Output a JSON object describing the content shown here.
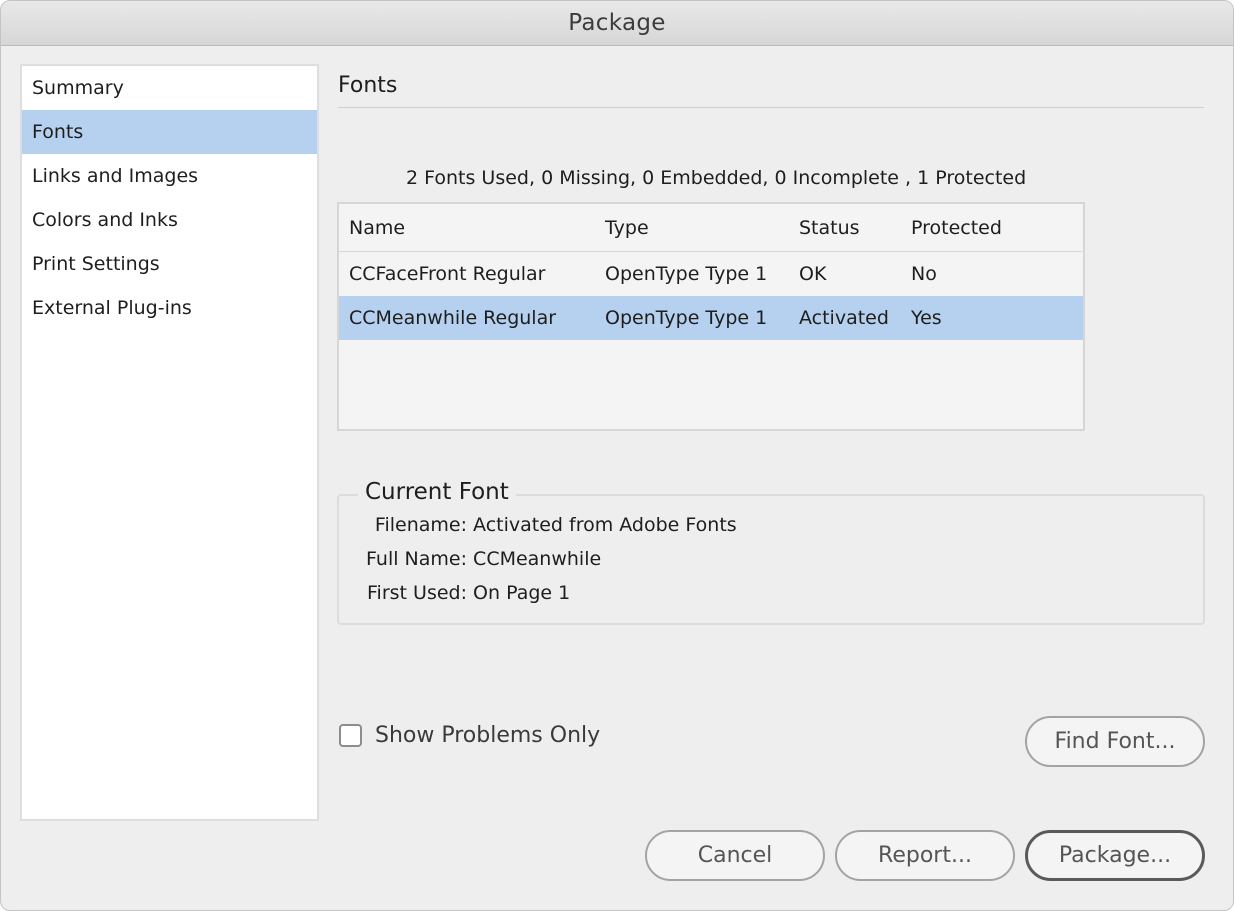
{
  "window": {
    "title": "Package"
  },
  "sidebar": {
    "items": [
      {
        "label": "Summary"
      },
      {
        "label": "Fonts"
      },
      {
        "label": "Links and Images"
      },
      {
        "label": "Colors and Inks"
      },
      {
        "label": "Print Settings"
      },
      {
        "label": "External Plug-ins"
      }
    ],
    "selected": "Fonts"
  },
  "fonts_section": {
    "title": "Fonts",
    "summary": "2 Fonts Used, 0 Missing, 0 Embedded, 0 Incomplete , 1 Protected",
    "table": {
      "columns": [
        "Name",
        "Type",
        "Status",
        "Protected"
      ],
      "rows": [
        {
          "name": "CCFaceFront Regular",
          "type": "OpenType Type 1",
          "status": "OK",
          "protected": "No"
        },
        {
          "name": "CCMeanwhile Regular",
          "type": "OpenType Type 1",
          "status": "Activated",
          "protected": "Yes"
        }
      ],
      "selected_row": 1
    }
  },
  "current_font": {
    "legend": "Current Font",
    "filename_label": "Filename:",
    "filename_value": "Activated from Adobe Fonts",
    "fullname_label": "Full Name:",
    "fullname_value": "CCMeanwhile",
    "firstused_label": "First Used:",
    "firstused_value": "On Page 1"
  },
  "options": {
    "show_problems_only": {
      "label": "Show Problems Only",
      "checked": false
    }
  },
  "buttons": {
    "find_font": "Find Font...",
    "cancel": "Cancel",
    "report": "Report...",
    "package": "Package..."
  },
  "colors": {
    "selection": "#b5d1ef",
    "background": "#eeeeee"
  }
}
